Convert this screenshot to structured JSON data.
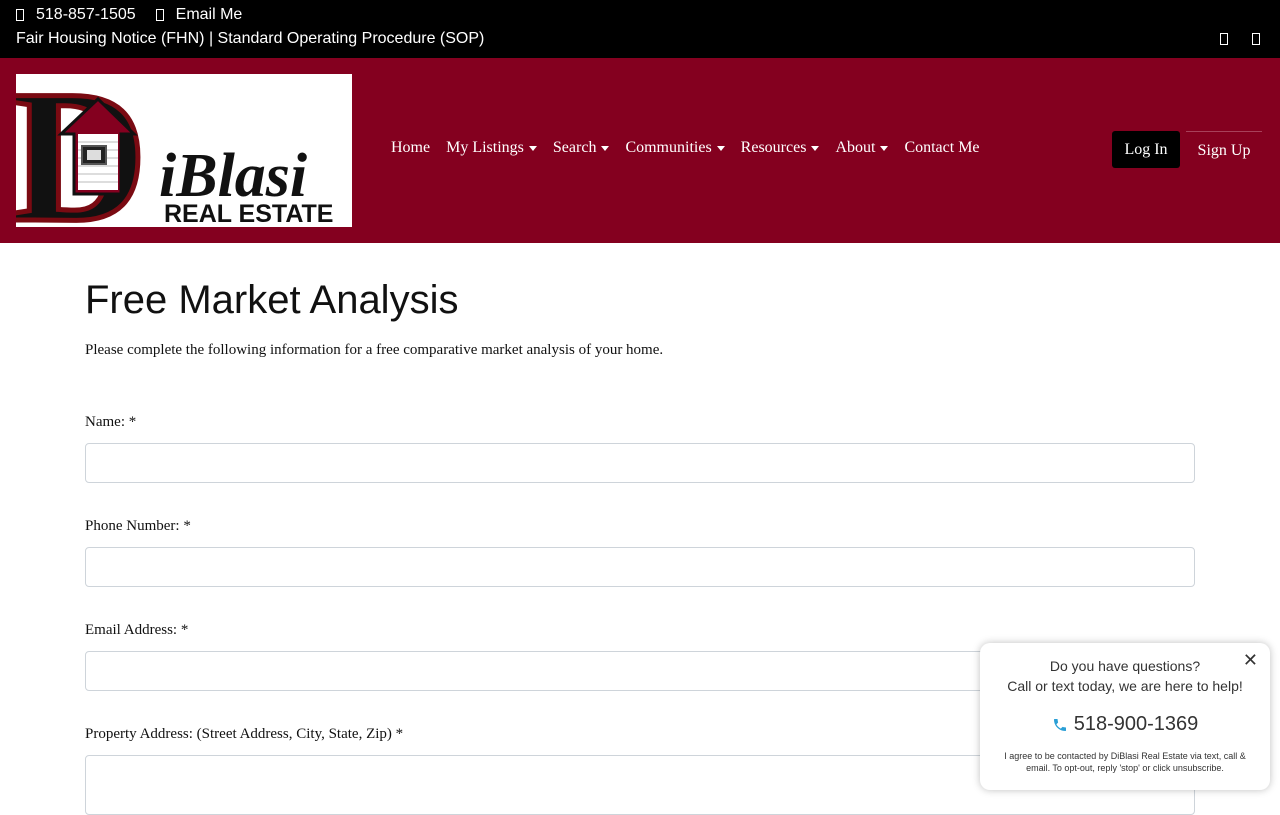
{
  "topbar": {
    "phone": "518-857-1505",
    "email": "Email Me",
    "fhn": "Fair Housing Notice (FHN)",
    "sep": "|",
    "sop": "Standard Operating Procedure (SOP)"
  },
  "logo": {
    "letter": "D",
    "name": "iBlasi",
    "sub": "REAL ESTATE"
  },
  "nav": {
    "items": [
      "Home",
      "My Listings",
      "Search",
      "Communities",
      "Resources",
      "About",
      "Contact Me"
    ],
    "login": "Log In",
    "signup": "Sign Up"
  },
  "main": {
    "title": "Free Market Analysis",
    "intro": "Please complete the following information for a free comparative market analysis of your home.",
    "fields": [
      {
        "label": "Name: *"
      },
      {
        "label": "Phone Number: *"
      },
      {
        "label": "Email Address: *"
      },
      {
        "label": "Property Address: (Street Address, City, State, Zip) *"
      }
    ]
  },
  "chat": {
    "close": "✕",
    "line1": "Do you have questions?",
    "line2": "Call or text today, we are here to help!",
    "phone": "518-900-1369",
    "consent": "I agree to be contacted by DiBlasi Real Estate via text, call & email. To opt-out, reply 'stop' or click unsubscribe."
  },
  "colors": {
    "brand": "#84001f",
    "topbar": "#000000",
    "phone_icon": "#2a9fd6"
  }
}
